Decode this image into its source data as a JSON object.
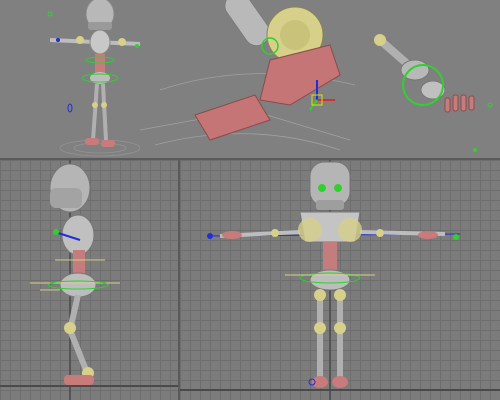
{
  "viewports": [
    {
      "id": "perspective-full",
      "label": ""
    },
    {
      "id": "perspective-foot",
      "label": ""
    },
    {
      "id": "perspective-hand",
      "label": ""
    },
    {
      "id": "left-view",
      "label": ""
    },
    {
      "id": "front-view",
      "label": ""
    }
  ],
  "colors": {
    "background": "#7b7b7b",
    "grid": "#6e6e6e",
    "metal": "#b9b9b9",
    "joint": "#d6d08a",
    "foot": "#c97a7a",
    "rig_green": "#2fd12f",
    "rig_blue": "#1f2fd6"
  },
  "icons": [
    "robot-character",
    "ik-control-circle",
    "bone-handle",
    "gizmo-axis"
  ]
}
